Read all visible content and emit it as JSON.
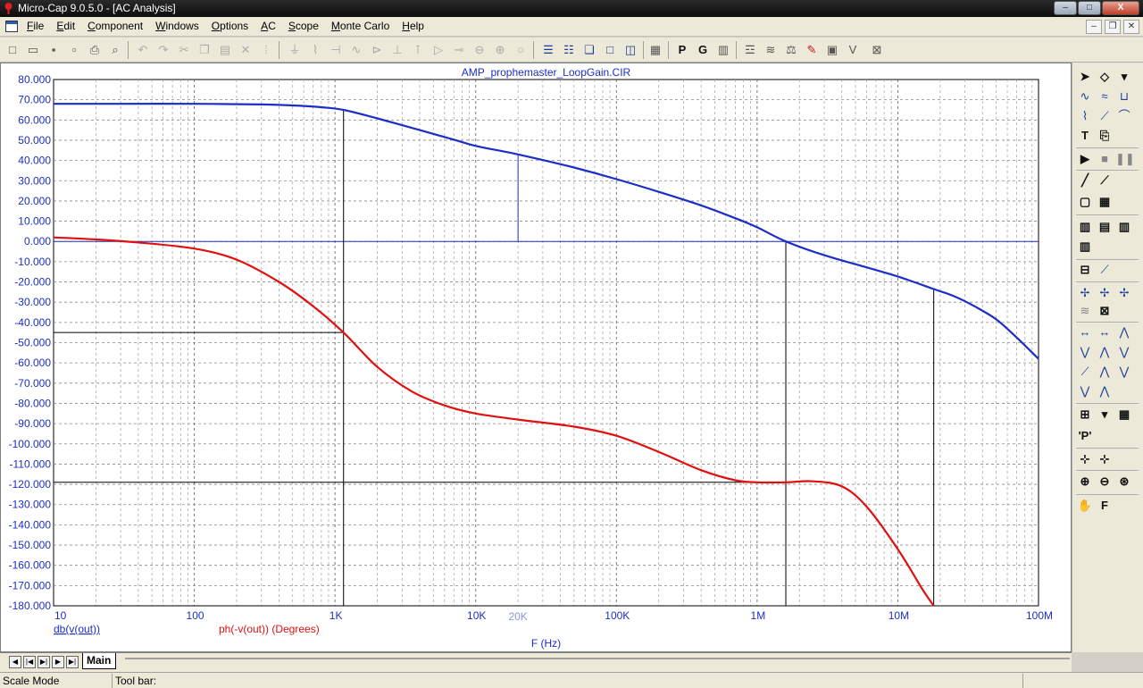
{
  "window": {
    "title": "Micro-Cap 9.0.5.0 - [AC Analysis]",
    "controls": [
      "–",
      "□",
      "X"
    ]
  },
  "menu": {
    "items": [
      "File",
      "Edit",
      "Component",
      "Windows",
      "Options",
      "AC",
      "Scope",
      "Monte Carlo",
      "Help"
    ],
    "mdi_controls": [
      "–",
      "❐",
      "✕"
    ]
  },
  "palette": {
    "text_tool": "T",
    "probe_label": "'P'",
    "font_tool": "F"
  },
  "tabs": {
    "main_label": "Main"
  },
  "status": {
    "mode": "Scale Mode",
    "toolbar_label": "Tool bar:"
  },
  "colors": {
    "gain_curve": "#1c2ec8",
    "phase_curve": "#e01010",
    "axis_text": "#1c2ec8",
    "phase_label": "#e01010",
    "cursor_line": "#000000"
  },
  "chart_data": {
    "type": "line",
    "title": "AMP_prophemaster_LoopGain.CIR",
    "xlabel": "F (Hz)",
    "x_scale": "log",
    "xlim": [
      10,
      100000000
    ],
    "ylim": [
      -180,
      80
    ],
    "grid": true,
    "y_ticks": [
      80,
      70,
      60,
      50,
      40,
      30,
      20,
      10,
      0,
      -10,
      -20,
      -30,
      -40,
      -50,
      -60,
      -70,
      -80,
      -90,
      -100,
      -110,
      -120,
      -130,
      -140,
      -150,
      -160,
      -170,
      -180
    ],
    "y_tick_labels": [
      "80.000",
      "70.000",
      "60.000",
      "50.000",
      "40.000",
      "30.000",
      "20.000",
      "10.000",
      "0.000",
      "-10.000",
      "-20.000",
      "-30.000",
      "-40.000",
      "-50.000",
      "-60.000",
      "-70.000",
      "-80.000",
      "-90.000",
      "-100.000",
      "-110.000",
      "-120.000",
      "-130.000",
      "-140.000",
      "-150.000",
      "-160.000",
      "-170.000",
      "-180.000"
    ],
    "x_ticks": [
      10,
      100,
      1000,
      10000,
      100000,
      1000000,
      10000000,
      100000000
    ],
    "x_tick_labels": [
      "10",
      "100",
      "1K",
      "10K",
      "100K",
      "1M",
      "10M",
      "100M"
    ],
    "x_marker": {
      "value": 20000,
      "label": "20K"
    },
    "series": [
      {
        "name": "db(v(out))",
        "unit": "",
        "x": [
          10,
          30,
          100,
          300,
          500,
          800,
          1150,
          2000,
          4000,
          7000,
          10000,
          20000,
          50000,
          100000,
          200000,
          400000,
          700000,
          1000000,
          1600000,
          3000000,
          6000000,
          10000000,
          18000000,
          25000000,
          35000000,
          50000000,
          70000000,
          100000000
        ],
        "y": [
          68,
          68,
          68,
          67.7,
          67.2,
          66.3,
          65,
          60.8,
          55,
          50.3,
          47.2,
          43,
          36.5,
          30.8,
          24.5,
          17.8,
          11.5,
          7,
          0,
          -6.8,
          -12.8,
          -17.3,
          -23.5,
          -27,
          -32,
          -38.5,
          -47.5,
          -58
        ]
      },
      {
        "name": "ph(-v(out))",
        "unit": "(Degrees)",
        "x": [
          10,
          20,
          40,
          100,
          200,
          400,
          700,
          1150,
          2000,
          3500,
          6000,
          10000,
          20000,
          50000,
          100000,
          200000,
          400000,
          700000,
          1000000,
          1600000,
          2500000,
          4000000,
          6000000,
          10000000,
          15000000,
          18000000
        ],
        "y": [
          2,
          1,
          -0.5,
          -3.5,
          -9,
          -20,
          -32,
          -45,
          -62,
          -74,
          -81,
          -85,
          -88,
          -91.5,
          -96,
          -104,
          -113,
          -118,
          -119,
          -119,
          -118.5,
          -121,
          -131,
          -152,
          -172,
          -180
        ]
      }
    ],
    "cursors": [
      {
        "x": 1150,
        "gain": 65,
        "phase": -45
      },
      {
        "x": 20000,
        "gain": 43
      },
      {
        "x": 1600000,
        "gain": 0,
        "phase": -119
      },
      {
        "x": 18000000,
        "gain": -23.5,
        "phase": -180
      }
    ]
  }
}
